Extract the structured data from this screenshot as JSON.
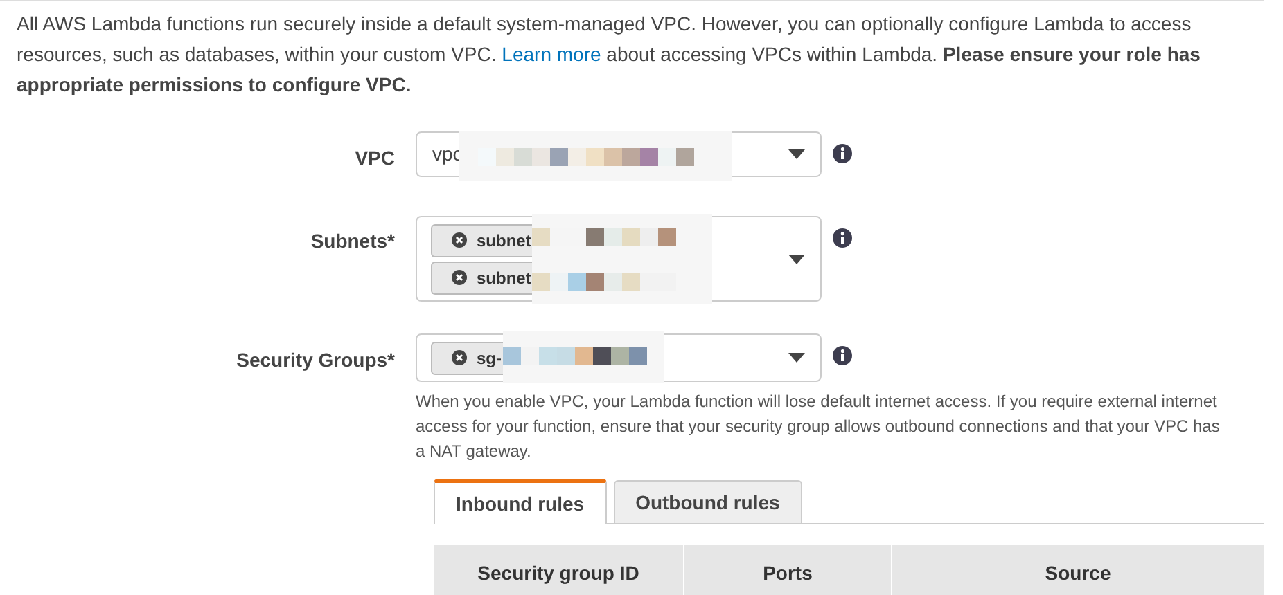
{
  "intro": {
    "before": "All AWS Lambda functions run securely inside a default system-managed VPC. However, you can optionally configure Lambda to access resources, such as databases, within your custom VPC. ",
    "link": "Learn more",
    "after": " about accessing VPCs within Lambda. **Please ensure your role has appropriate permissions to configure VPC.**"
  },
  "fields": [
    {
      "label": "VPC",
      "kind": "select",
      "value": "vpc"
    },
    {
      "label": "Subnets*",
      "kind": "multi",
      "chips": [
        "subnet",
        "subnet"
      ]
    },
    {
      "label": "Security Groups*",
      "kind": "multi",
      "chips": [
        "sg-"
      ],
      "help": "When you enable VPC, your Lambda function will lose default internet access. If you require external internet access for your function, ensure that your security group allows outbound connections and that your VPC has a NAT gateway."
    }
  ],
  "tabs": [
    {
      "label": "Inbound rules",
      "selected": true
    },
    {
      "label": "Outbound rules",
      "selected": false
    }
  ],
  "table": {
    "columns": [
      "Security group ID",
      "Ports",
      "Source"
    ]
  }
}
